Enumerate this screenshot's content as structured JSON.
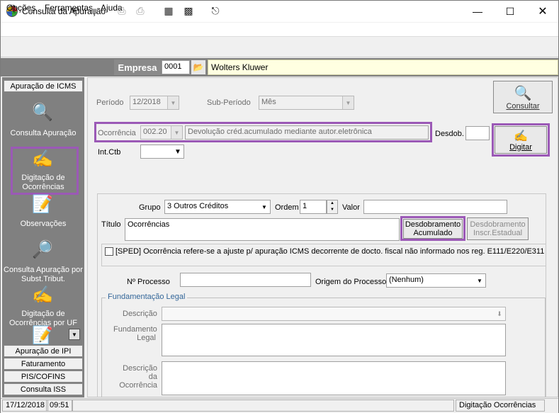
{
  "window": {
    "title": "Consulta da Apuração"
  },
  "menu": {
    "items": [
      "Opções",
      "Ferramentas",
      "Ajuda"
    ]
  },
  "empresa": {
    "label": "Empresa",
    "code": "0001",
    "name": "Wolters Kluwer"
  },
  "sidebar": {
    "tabs": [
      "Apuração de ICMS",
      "Apuração de IPI",
      "Faturamento",
      "PIS/COFINS",
      "Consulta ISS"
    ],
    "items": [
      {
        "label": "Consulta Apuração",
        "icon": "magnifier-computer-icon"
      },
      {
        "label": "Digitação de Ocorrências",
        "icon": "hand-writing-icon"
      },
      {
        "label": "Observações",
        "icon": "notepad-icon"
      },
      {
        "label": "Consulta  Apuração por Subst.Tribut.",
        "icon": "st-magnifier-icon"
      },
      {
        "label": "Digitação de Ocorrências por UF",
        "icon": "st-writing-icon"
      }
    ]
  },
  "form": {
    "periodo_label": "Período",
    "periodo_value": "12/2018",
    "subperiodo_label": "Sub-Período",
    "subperiodo_value": "Mês",
    "consultar_label": "Consultar",
    "ocorrencia_label": "Ocorrência",
    "ocorrencia_code": "002.20",
    "ocorrencia_desc": "Devolução créd.acumulado mediante autor.eletrônica",
    "desdob_label": "Desdob.",
    "digitar_label": "Digitar",
    "intctb_label": "Int.Ctb",
    "grupo_label": "Grupo",
    "grupo_value": "3  Outros Créditos",
    "ordem_label": "Ordem",
    "ordem_value": "1",
    "valor_label": "Valor",
    "titulo_label": "Título",
    "titulo_value": "Ocorrências",
    "desdob_acum_label": "Desdobramento Acumulado",
    "desdob_inscr_label": "Desdobramento Inscr.Estadual",
    "sped_text": "[SPED] Ocorrência refere-se a ajuste p/ apuração ICMS decorrente de docto. fiscal não informado nos reg. E111/E220/E311",
    "nprocesso_label": "Nº Processo",
    "origem_label": "Origem do Processo",
    "origem_value": "(Nenhum)",
    "fund_group_label": "Fundamentação Legal",
    "descricao_label": "Descrição",
    "fundamento_label": "Fundamento Legal",
    "desc_ocorrencia_label": "Descrição da Ocorrência"
  },
  "status": {
    "date": "17/12/2018",
    "time": "09:51",
    "screen": "Digitação Ocorrências"
  },
  "colors": {
    "highlight": "#9b59b6",
    "empresa_bg": "#ffffe1",
    "sidebar_bg": "#808080"
  }
}
